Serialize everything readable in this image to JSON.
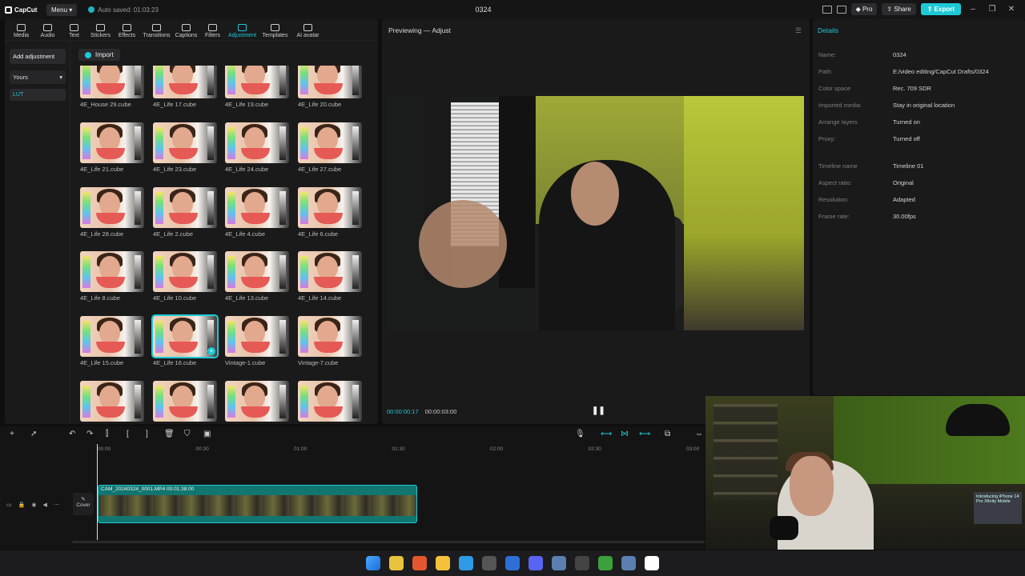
{
  "titlebar": {
    "app_name": "CapCut",
    "menu_label": "Menu",
    "autosave": "Auto saved: 01:03:23",
    "project_title": "0324",
    "pro_label": "Pro",
    "share_label": "Share",
    "export_label": "Export"
  },
  "toolbar": {
    "tabs": [
      "Media",
      "Audio",
      "Text",
      "Stickers",
      "Effects",
      "Transitions",
      "Captions",
      "Filters",
      "Adjustment",
      "Templates",
      "AI avatar"
    ],
    "active": "Adjustment"
  },
  "sidemenu": {
    "add_adjustment": "Add adjustment",
    "yours": "Yours",
    "lut": "LUT"
  },
  "library": {
    "import_label": "Import",
    "items": [
      "4E_House 29.cube",
      "4E_Life 17.cube",
      "4E_Life 19.cube",
      "4E_Life 20.cube",
      "4E_Life 21.cube",
      "4E_Life 23.cube",
      "4E_Life 24.cube",
      "4E_Life 27.cube",
      "4E_Life 28.cube",
      "4E_Life 2.cube",
      "4E_Life 4.cube",
      "4E_Life 6.cube",
      "4E_Life 8.cube",
      "4E_Life 10.cube",
      "4E_Life 13.cube",
      "4E_Life 14.cube",
      "4E_Life 15.cube",
      "4E_Life 16.cube",
      "Vintage-1.cube",
      "Vintage-7.cube",
      "",
      "",
      "",
      ""
    ],
    "selected_index": 17
  },
  "preview": {
    "title": "Previewing — Adjust",
    "current_time": "00:00:00:17",
    "duration": "00:00:03:00"
  },
  "details": {
    "title": "Details",
    "rows": [
      {
        "k": "Name:",
        "v": "0324"
      },
      {
        "k": "Path:",
        "v": "E:/video editing/CapCut Drafts/0324"
      },
      {
        "k": "Color space",
        "v": "Rec. 709 SDR"
      },
      {
        "k": "Imported media:",
        "v": "Stay in original location"
      },
      {
        "k": "Arrange layers",
        "v": "Turned on"
      },
      {
        "k": "Proxy:",
        "v": "Turned off"
      },
      {
        "k": "Timeline name",
        "v": "Timeline 01"
      },
      {
        "k": "Aspect ratio:",
        "v": "Original"
      },
      {
        "k": "Resolution:",
        "v": "Adapted"
      },
      {
        "k": "Frame rate:",
        "v": "30.00fps"
      }
    ]
  },
  "timeline": {
    "ticks": [
      "00:00",
      "00:30",
      "01:00",
      "01:30",
      "02:00",
      "02:30",
      "03:00"
    ],
    "clip_label": "CAM_20240324_0001.MP4   00:01:38:00",
    "cover_label": "Cover"
  },
  "webcam": {
    "sign_text": "Introducing iPhone 14 Pro Xfinity Mobile"
  },
  "taskbar": {
    "icons": [
      "windows-start",
      "chrome",
      "brave",
      "file-explorer",
      "edge",
      "store",
      "outlook",
      "discord",
      "steam",
      "epic-games",
      "xbox",
      "steam-2",
      "capcut"
    ],
    "colors": [
      "#3a8ee6",
      "#e8c33b",
      "#e4572e",
      "#f3c13a",
      "#2f9be6",
      "#555",
      "#2d6fd6",
      "#5865f2",
      "#5b7fb0",
      "#444",
      "#3ca03c",
      "#5b7fb0",
      "#ffffff"
    ]
  },
  "colors": {
    "accent": "#1ec9d6",
    "background": "#0f0f10",
    "panel": "#1a1a1b"
  }
}
